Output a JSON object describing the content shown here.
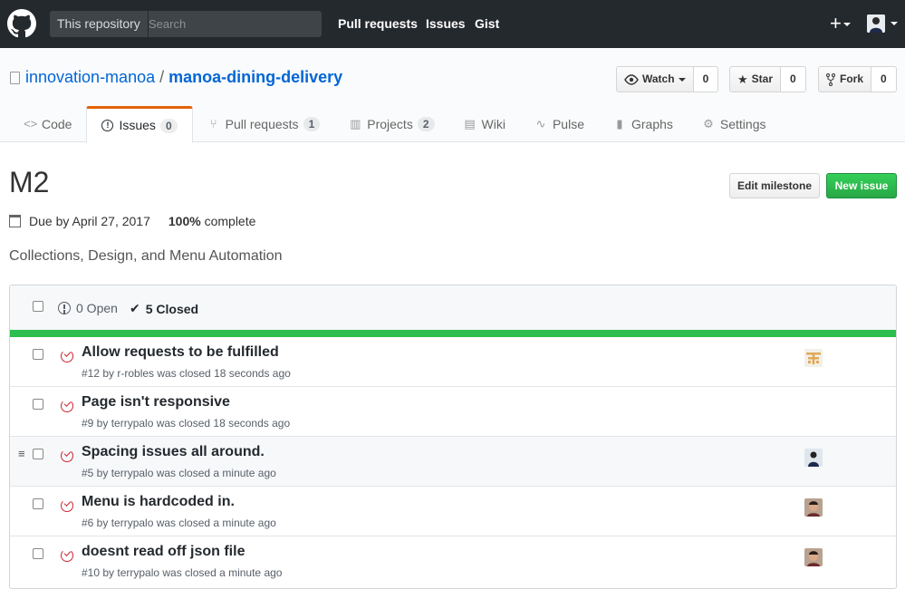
{
  "header": {
    "search_scope": "This repository",
    "search_placeholder": "Search",
    "nav": [
      "Pull requests",
      "Issues",
      "Gist"
    ]
  },
  "repo": {
    "owner": "innovation-manoa",
    "separator": "/",
    "name": "manoa-dining-delivery",
    "watch_label": "Watch",
    "watch_count": "0",
    "star_label": "Star",
    "star_count": "0",
    "fork_label": "Fork",
    "fork_count": "0"
  },
  "tabs": [
    {
      "label": "Code",
      "icon": "code-icon"
    },
    {
      "label": "Issues",
      "counter": "0",
      "icon": "issue-opened-icon"
    },
    {
      "label": "Pull requests",
      "counter": "1",
      "icon": "pull-request-icon"
    },
    {
      "label": "Projects",
      "counter": "2",
      "icon": "project-icon"
    },
    {
      "label": "Wiki",
      "icon": "book-icon"
    },
    {
      "label": "Pulse",
      "icon": "pulse-icon"
    },
    {
      "label": "Graphs",
      "icon": "graph-icon"
    },
    {
      "label": "Settings",
      "icon": "gear-icon"
    }
  ],
  "milestone": {
    "title": "M2",
    "edit_label": "Edit milestone",
    "new_issue_label": "New issue",
    "due": "Due by April 27, 2017",
    "percent": "100%",
    "complete_label": "complete",
    "description": "Collections, Design, and Menu Automation",
    "progress": 1.0
  },
  "issues_header": {
    "open_label": "0 Open",
    "closed_label": "5 Closed"
  },
  "issues": [
    {
      "title": "Allow requests to be fulfilled",
      "meta": "#12 by r-robles was closed 18 seconds ago",
      "avatar": "identicon"
    },
    {
      "title": "Page isn't responsive",
      "meta": "#9 by terrypalo was closed 18 seconds ago",
      "avatar": ""
    },
    {
      "title": "Spacing issues all around.",
      "meta": "#5 by terrypalo was closed a minute ago",
      "avatar": "person-dark"
    },
    {
      "title": "Menu is hardcoded in.",
      "meta": "#6 by terrypalo was closed a minute ago",
      "avatar": "person-photo"
    },
    {
      "title": "doesnt read off json file",
      "meta": "#10 by terrypalo was closed a minute ago",
      "avatar": "person-photo"
    }
  ],
  "colors": {
    "header_bg": "#24292e",
    "link": "#0366d6",
    "progress": "#2cbe4e",
    "closed_icon": "#cb2431",
    "selected_tab_accent": "#e36209"
  }
}
